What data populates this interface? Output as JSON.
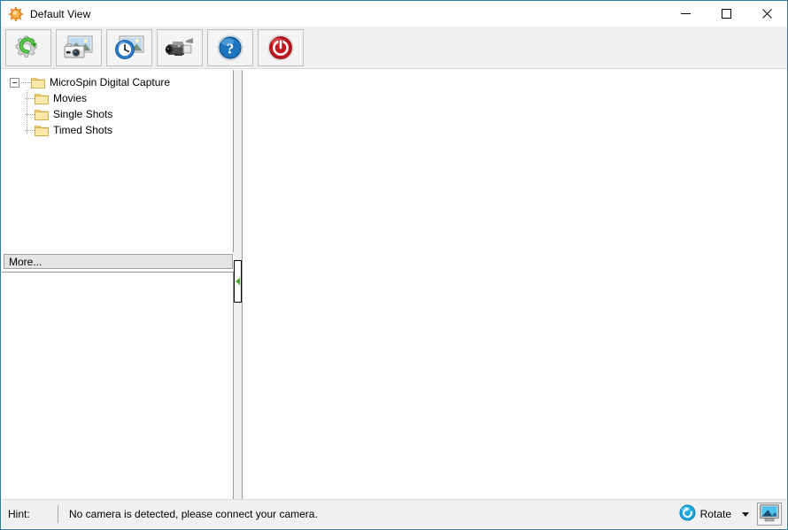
{
  "window": {
    "title": "Default View",
    "title_icon": "gear-sun-icon",
    "minimize_label": "─",
    "maximize_label": "□",
    "close_label": "✕"
  },
  "toolbar": {
    "buttons": [
      {
        "name": "settings-capture-button",
        "icon": "gear-refresh-icon",
        "tooltip": "Settings"
      },
      {
        "name": "single-shot-button",
        "icon": "camera-photo-icon",
        "tooltip": "Single Shot"
      },
      {
        "name": "timed-shot-button",
        "icon": "clock-photo-icon",
        "tooltip": "Timed Shot"
      },
      {
        "name": "movie-capture-button",
        "icon": "camcorder-icon",
        "tooltip": "Movie"
      },
      {
        "name": "help-button",
        "icon": "help-question-icon",
        "tooltip": "Help"
      },
      {
        "name": "exit-button",
        "icon": "power-off-icon",
        "tooltip": "Exit"
      }
    ]
  },
  "tree": {
    "root": {
      "label": "MicroSpin Digital Capture",
      "expanded": true
    },
    "children": [
      {
        "label": "Movies"
      },
      {
        "label": "Single Shots"
      },
      {
        "label": "Timed Shots"
      }
    ]
  },
  "sidebar": {
    "more_label": "More..."
  },
  "splitter": {
    "arrow_icon": "collapse-left-arrow-icon"
  },
  "statusbar": {
    "hint_label": "Hint:",
    "hint_text": "No camera is detected, please connect your camera.",
    "rotate_label": "Rotate",
    "rotate_icon": "rotate-clockwise-icon",
    "dropdown_icon": "chevron-down-icon",
    "fullscreen_icon": "monitor-icon"
  },
  "colors": {
    "window_border": "#2e7d9a",
    "toolbar_bg": "#f0f0f0",
    "folder_yellow": "#fddc86",
    "splitter_arrow_green": "#4aa32a",
    "rotate_blue": "#1ba7e0",
    "power_red": "#c81e27",
    "help_blue": "#1a6fb5"
  }
}
